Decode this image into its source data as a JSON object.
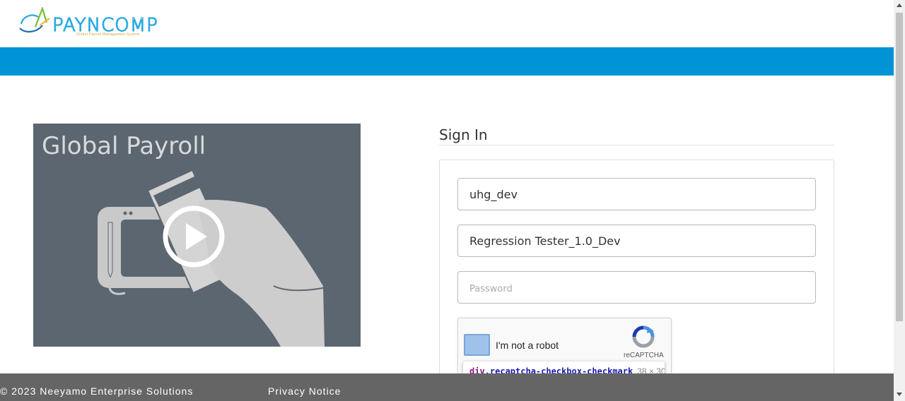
{
  "header": {
    "logo_text": "PAYNCOMP",
    "logo_tagline": "Global Payroll Management System"
  },
  "video": {
    "title": "Global Payroll",
    "play_icon": "play-icon"
  },
  "signin": {
    "title": "Sign In",
    "client_value": "uhg_dev",
    "user_value": "Regression Tester_1.0_Dev",
    "password_placeholder": "Password"
  },
  "captcha": {
    "label": "I'm not a robot",
    "brand": "reCAPTCHA",
    "tooltip_tag": "div",
    "tooltip_class": ".recaptcha-checkbox-checkmark",
    "tooltip_dims": "38 × 30"
  },
  "footer": {
    "copyright": "© 2023 Neeyamo Enterprise Solutions",
    "privacy": "Privacy Notice"
  },
  "colors": {
    "brand_blue": "#0093d6",
    "video_bg": "#5c6670",
    "footer_bg": "#656565"
  }
}
